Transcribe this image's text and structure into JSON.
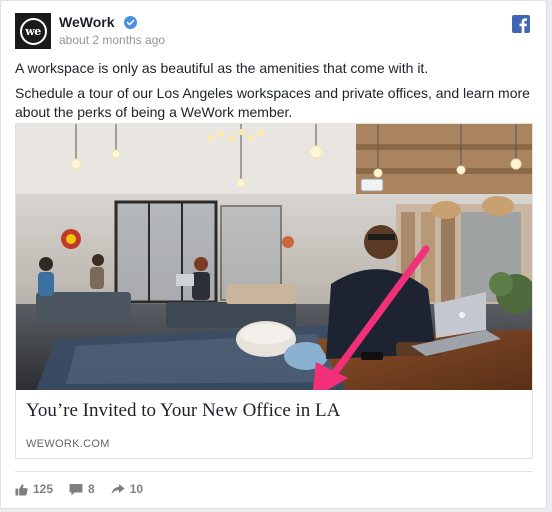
{
  "post": {
    "page_name": "WeWork",
    "avatar_text": "we",
    "verified_icon": "verified-badge-icon",
    "timestamp": "about 2 months ago",
    "platform_icon": "facebook-icon",
    "text_line_1": "A workspace is only as beautiful as the amenities that come with it.",
    "text_line_2": "Schedule a tour of our Los Angeles workspaces and private offices, and learn more about the perks of being a WeWork member."
  },
  "link_preview": {
    "title": "You’re Invited to Your New Office in LA",
    "domain": "WEWORK.COM",
    "annotation": "pink-arrow"
  },
  "stats": {
    "likes": "125",
    "comments": "8",
    "shares": "10"
  },
  "colors": {
    "brand_blue": "#4267b2",
    "verified_blue": "#4a90e2",
    "arrow_pink": "#f2307a"
  }
}
